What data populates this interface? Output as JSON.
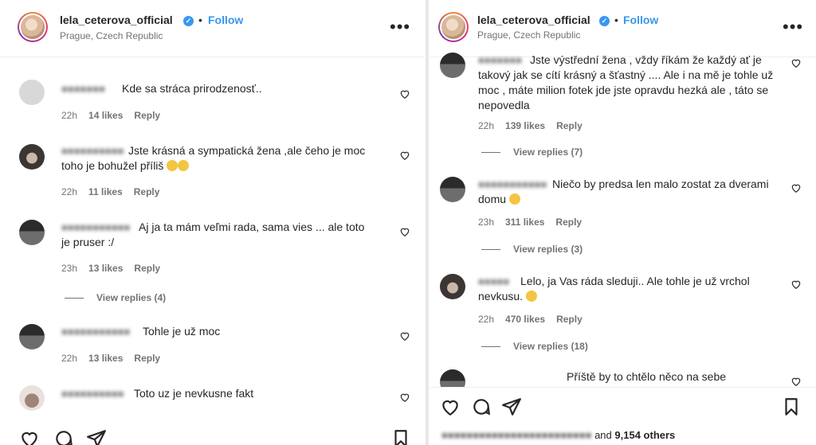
{
  "post": {
    "username": "lela_ceterova_official",
    "dot": "•",
    "follow_label": "Follow",
    "location": "Prague, Czech Republic",
    "more_label": "•••"
  },
  "left_comments": [
    {
      "text": "Kde sa stráca prirodzenosť..",
      "time": "22h",
      "likes": "14 likes",
      "reply": "Reply"
    },
    {
      "text_line1": "Jste krásná a sympatická žena ,ale čeho je moc",
      "text_line2": "toho je bohužel příliš",
      "time": "22h",
      "likes": "11 likes",
      "reply": "Reply"
    },
    {
      "text_line1": "Aj ja ta mám veľmi rada, sama vies ... ale toto",
      "text_line2": "je pruser :/",
      "time": "23h",
      "likes": "13 likes",
      "reply": "Reply",
      "view_replies": "View replies (4)"
    },
    {
      "text": "Tohle je už moc",
      "time": "22h",
      "likes": "13 likes",
      "reply": "Reply"
    },
    {
      "text": "Toto uz je nevkusne fakt"
    }
  ],
  "right_comments": [
    {
      "text_line1": "Jste výstřední žena , vždy říkám že každý ať je",
      "text_line2": "takový jak se cítí krásný a šťastný .... Ale i na mě je tohle už",
      "text_line3": "moc , máte milion fotek jde jste opravdu hezká ale , táto se",
      "text_line4": "nepovedla",
      "time": "22h",
      "likes": "139 likes",
      "reply": "Reply",
      "view_replies": "View replies (7)"
    },
    {
      "text_line1": "Niečo by predsa len malo zostat za dverami",
      "text_line2": "domu",
      "time": "23h",
      "likes": "311 likes",
      "reply": "Reply",
      "view_replies": "View replies (3)"
    },
    {
      "text_line1": "Lelo, ja Vas ráda sleduji.. Ale tohle je už vrchol",
      "text_line2": "nevkusu.",
      "time": "22h",
      "likes": "470 likes",
      "reply": "Reply",
      "view_replies": "View replies (18)"
    },
    {
      "text": "Příště by to chtělo něco na sebe"
    }
  ],
  "likes_summary": {
    "and": "and",
    "count": "9,154 others"
  },
  "icons": [
    "heart-icon",
    "comment-icon",
    "share-icon",
    "bookmark-icon",
    "verified-badge-icon",
    "more-options-icon"
  ]
}
